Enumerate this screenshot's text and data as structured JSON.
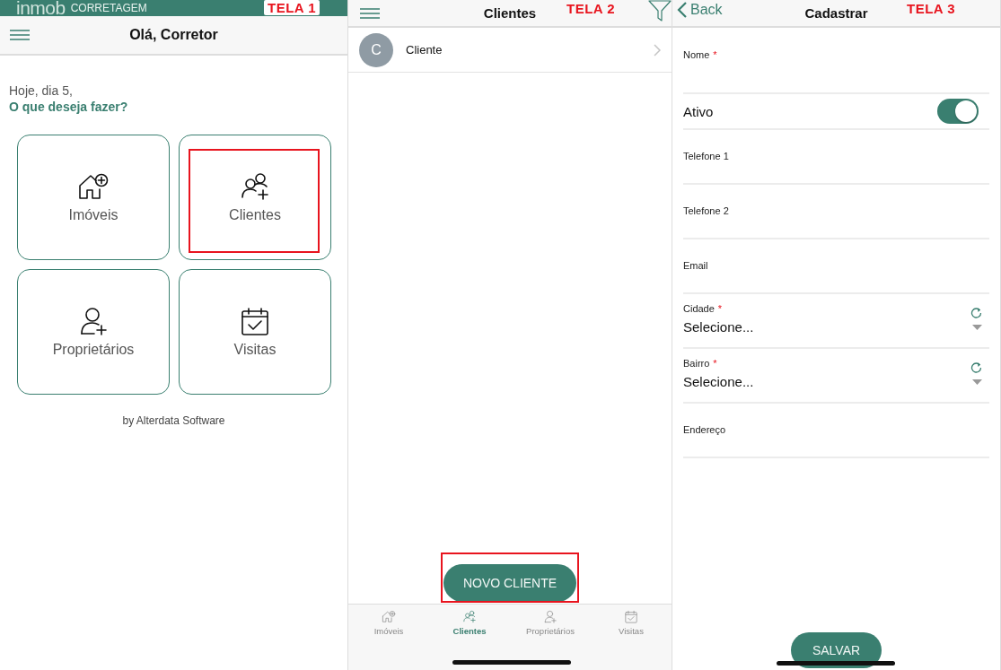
{
  "screen_1": {
    "logo": {
      "brand": "inmob",
      "tagline": "CORRETAGEM"
    },
    "annotation": "TELA 1",
    "title": "Olá, Corretor",
    "greeting": "Hoje, dia 5,",
    "question": "O que deseja fazer?",
    "tiles": [
      {
        "label": "Imóveis",
        "highlighted": false
      },
      {
        "label": "Clientes",
        "highlighted": true
      },
      {
        "label": "Proprietários",
        "highlighted": false
      },
      {
        "label": "Visitas",
        "highlighted": false
      }
    ],
    "footer": "by Alterdata Software"
  },
  "screen_2": {
    "title": "Clientes",
    "annotation": "TELA 2",
    "rows": [
      {
        "initial": "C",
        "name": "Cliente"
      }
    ],
    "button": {
      "label": "NOVO CLIENTE",
      "highlighted": true
    },
    "tabs": [
      {
        "label": "Imóveis",
        "selected": false
      },
      {
        "label": "Clientes",
        "selected": true
      },
      {
        "label": "Proprietários",
        "selected": false
      },
      {
        "label": "Visitas",
        "selected": false
      }
    ]
  },
  "screen_3": {
    "back": "Back",
    "title": "Cadastrar",
    "annotation": "TELA 3",
    "fields": [
      {
        "kind": "text",
        "label": "Nome",
        "required_mark": "*"
      },
      {
        "kind": "toggle",
        "label": "Ativo",
        "on": true
      },
      {
        "kind": "text",
        "label": "Telefone 1"
      },
      {
        "kind": "text",
        "label": "Telefone 2"
      },
      {
        "kind": "text",
        "label": "Email"
      },
      {
        "kind": "select",
        "label": "Cidade",
        "required_mark": "*",
        "value": "Selecione..."
      },
      {
        "kind": "select",
        "label": "Bairro",
        "required_mark": "*",
        "value": "Selecione..."
      },
      {
        "kind": "text",
        "label": "Endereço"
      }
    ],
    "button": "SALVAR"
  }
}
